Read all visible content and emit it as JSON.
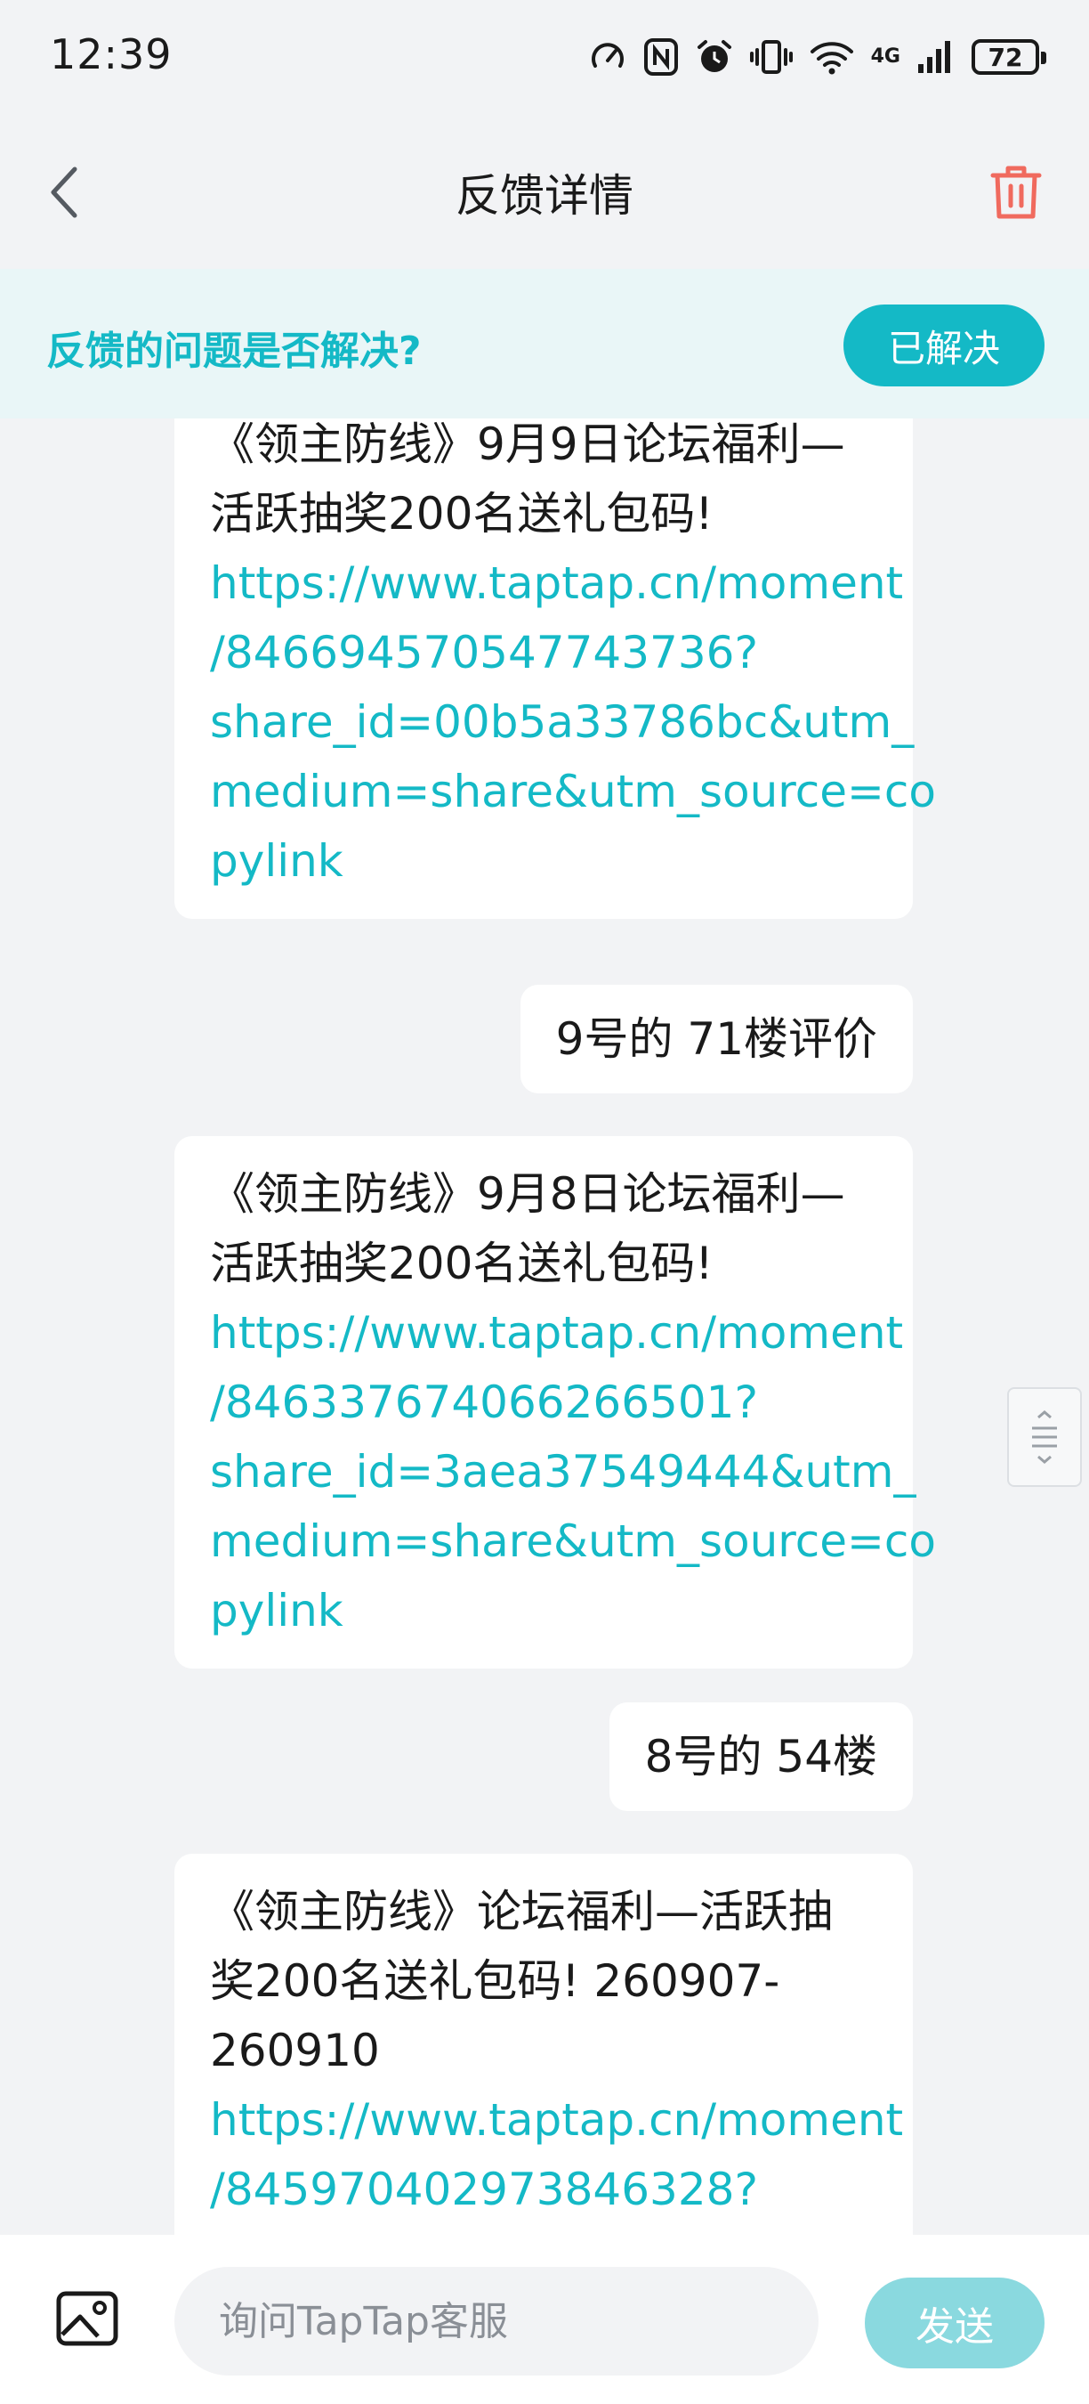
{
  "status_bar": {
    "time": "12:39",
    "network_label": "4G",
    "battery_level": "72",
    "icons": [
      "speedometer-icon",
      "nfc-icon",
      "alarm-icon",
      "vibrate-icon",
      "wifi-icon",
      "signal-icon",
      "battery-icon"
    ]
  },
  "header": {
    "title": "反馈详情",
    "back_icon": "chevron-left-icon",
    "delete_icon": "trash-icon"
  },
  "resolve_banner": {
    "question": "反馈的问题是否解决?",
    "button_label": "已解决"
  },
  "messages": [
    {
      "side": "received",
      "lines": [
        "《领主防线》9月9日论坛福利—",
        "活跃抽奖200名送礼包码!",
        "https://www.taptap.cn/moment",
        "/846694570547743736?",
        "share_id=00b5a33786bc&utm_",
        "medium=share&utm_source=co",
        "pylink"
      ]
    },
    {
      "side": "sent",
      "lines": [
        "9号的 71楼评价"
      ]
    },
    {
      "side": "received",
      "lines": [
        "《领主防线》9月8日论坛福利—",
        "活跃抽奖200名送礼包码!",
        "https://www.taptap.cn/moment",
        "/846337674066266501?",
        "share_id=3aea37549444&utm_",
        "medium=share&utm_source=co",
        "pylink"
      ]
    },
    {
      "side": "sent",
      "lines": [
        "8号的 54楼"
      ]
    },
    {
      "side": "received",
      "lines": [
        "《领主防线》论坛福利—活跃抽",
        "奖200名送礼包码! 260907-",
        "260910",
        "https://www.taptap.cn/moment",
        "/845970402973846328?"
      ]
    }
  ],
  "input_bar": {
    "placeholder": "询问TapTap客服",
    "value": "",
    "send_label": "发送",
    "image_icon": "image-icon"
  },
  "colors": {
    "accent": "#14b9c6",
    "accent_light": "#8ad9df",
    "delete": "#f06a5e",
    "background": "#f2f3f5",
    "banner_background": "#e9f6f7"
  }
}
